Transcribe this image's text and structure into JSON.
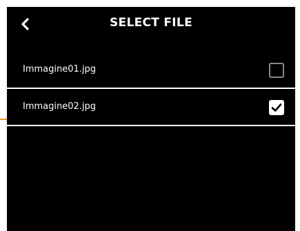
{
  "header": {
    "title": "SELECT FILE",
    "back_icon": "chevron-left-icon"
  },
  "files": [
    {
      "name": "Immagine01.jpg",
      "checked": false
    },
    {
      "name": "Immagine02.jpg",
      "checked": true
    }
  ],
  "colors": {
    "background": "#000000",
    "text": "#ffffff",
    "checkbox_unchecked_border": "#8a8a8a",
    "accent": "#e8951e"
  }
}
